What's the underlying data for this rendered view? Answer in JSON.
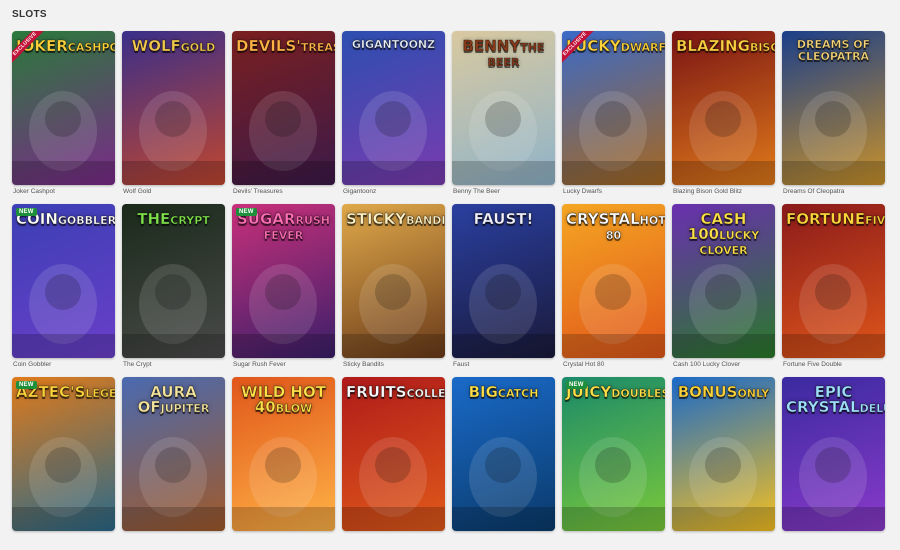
{
  "section": {
    "title": "SLOTS"
  },
  "games": [
    {
      "name": "Joker Cashpot",
      "logo": "Joker",
      "logo_sub": "Cashpot",
      "bg": [
        "#2a7a3a",
        "#7b2a8a"
      ],
      "logo_color": "#ffd43b",
      "ribbon": "EXCLUSIVE"
    },
    {
      "name": "Wolf Gold",
      "logo": "Wolf",
      "logo_sub": "Gold",
      "bg": [
        "#3a2f8a",
        "#c0462e"
      ],
      "logo_color": "#f2c94c"
    },
    {
      "name": "Devils' Treasures",
      "logo": "Devils'",
      "logo_sub": "Treasures",
      "bg": [
        "#7a1f1f",
        "#3c1a4a"
      ],
      "logo_color": "#ffb347"
    },
    {
      "name": "Gigantoonz",
      "logo": "Gigantoonz",
      "bg": [
        "#2c4fb0",
        "#7a3bb0"
      ],
      "logo_color": "#e8f2ff",
      "small": true
    },
    {
      "name": "Benny The Beer",
      "logo": "Benny",
      "logo_sub": "the Beer",
      "bg": [
        "#d9c9a0",
        "#8fb3c9"
      ],
      "logo_color": "#8a3b1a"
    },
    {
      "name": "Lucky Dwarfs",
      "logo": "Lucky",
      "logo_sub": "Dwarfs",
      "bg": [
        "#3a6ac9",
        "#a7681f"
      ],
      "logo_color": "#ffd43b",
      "ribbon": "EXCLUSIVE"
    },
    {
      "name": "Blazing Bison Gold Blitz",
      "logo": "Blazing",
      "logo_sub": "Bison",
      "bg": [
        "#7a1414",
        "#e07a1a"
      ],
      "logo_color": "#ffcf40"
    },
    {
      "name": "Dreams Of Cleopatra",
      "logo": "Dreams of Cleopatra",
      "bg": [
        "#1b3f8a",
        "#c9922a"
      ],
      "logo_color": "#f5d67a",
      "small": true
    },
    {
      "name": "Coin Gobbler",
      "logo": "Coin",
      "logo_sub": "Gobbler",
      "bg": [
        "#3b3fb5",
        "#6a3fc9"
      ],
      "logo_color": "#ffffff",
      "badge": "NEW"
    },
    {
      "name": "The Crypt",
      "logo": "The",
      "logo_sub": "Crypt",
      "bg": [
        "#1a2a1a",
        "#4a4a4a"
      ],
      "logo_color": "#7ee04a"
    },
    {
      "name": "Sugar Rush Fever",
      "logo": "Sugar",
      "logo_sub": "Rush Fever",
      "bg": [
        "#c9307a",
        "#3a1f6a"
      ],
      "logo_color": "#ff6fb5",
      "badge": "NEW"
    },
    {
      "name": "Sticky Bandits",
      "logo": "Sticky",
      "logo_sub": "Bandits",
      "bg": [
        "#e0a94a",
        "#6a3a1a"
      ],
      "logo_color": "#fff0c0"
    },
    {
      "name": "Faust",
      "logo": "Faust!",
      "bg": [
        "#2a3fa0",
        "#1a1a3a"
      ],
      "logo_color": "#f0f0ff"
    },
    {
      "name": "Crystal Hot 80",
      "logo": "Crystal",
      "logo_sub": "Hot 80",
      "bg": [
        "#f5a623",
        "#e0561a"
      ],
      "logo_color": "#ffffff"
    },
    {
      "name": "Cash 100 Lucky Clover",
      "logo": "Cash 100",
      "logo_sub": "Lucky Clover",
      "bg": [
        "#6a2fb0",
        "#2a7a2a"
      ],
      "logo_color": "#ffe14a"
    },
    {
      "name": "Fortune Five Double",
      "logo": "Fortune",
      "logo_sub": "Five",
      "bg": [
        "#8a1a1a",
        "#e0561a"
      ],
      "logo_color": "#ffd43b"
    },
    {
      "name": "",
      "logo": "Aztec's",
      "logo_sub": "Legend",
      "bg": [
        "#e07a1a",
        "#2a6a8a"
      ],
      "logo_color": "#ffd43b",
      "badge": "NEW"
    },
    {
      "name": "",
      "logo": "Aura of",
      "logo_sub": "Jupiter",
      "bg": [
        "#4a6ab0",
        "#a05a2a"
      ],
      "logo_color": "#f5e6a0"
    },
    {
      "name": "",
      "logo": "Wild Hot 40",
      "logo_sub": "Blow",
      "bg": [
        "#e0561a",
        "#ffb347"
      ],
      "logo_color": "#ffe14a"
    },
    {
      "name": "",
      "logo": "Fruits",
      "logo_sub": "Collection",
      "bg": [
        "#b01a1a",
        "#e05a1a"
      ],
      "logo_color": "#ffffff"
    },
    {
      "name": "",
      "logo": "Big",
      "logo_sub": "Catch",
      "bg": [
        "#1a6ac9",
        "#0a3a6a"
      ],
      "logo_color": "#ffe14a"
    },
    {
      "name": "",
      "logo": "Juicy",
      "logo_sub": "Doubles",
      "bg": [
        "#1a8a6a",
        "#7ac93a"
      ],
      "logo_color": "#ffe14a",
      "badge": "NEW"
    },
    {
      "name": "",
      "logo": "Bonus",
      "logo_sub": "Only",
      "bg": [
        "#1a6ac9",
        "#f5c020"
      ],
      "logo_color": "#ffd43b"
    },
    {
      "name": "",
      "logo": "Epic Crystal",
      "logo_sub": "Deluxe",
      "bg": [
        "#3a2aa0",
        "#8a3ac9"
      ],
      "logo_color": "#9fe0ff"
    }
  ]
}
